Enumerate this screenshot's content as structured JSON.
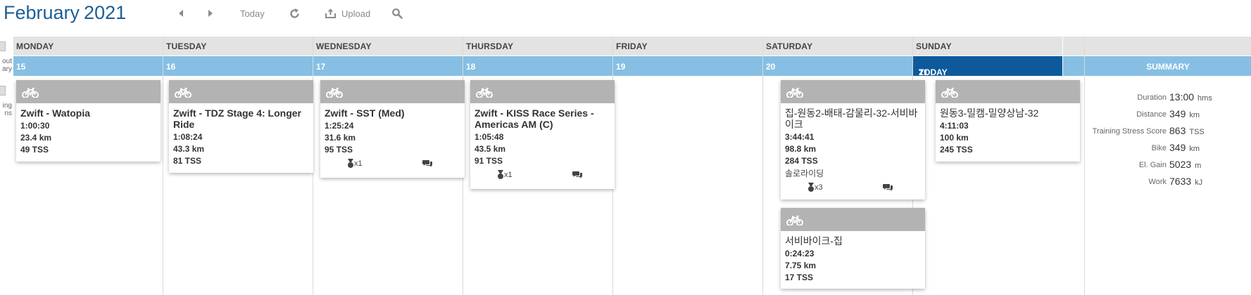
{
  "header": {
    "month": "February",
    "year": "2021",
    "today_label": "Today",
    "upload_label": "Upload"
  },
  "left_panel": {
    "item1_lines": [
      "out",
      "ary"
    ],
    "item2_lines": [
      "ing",
      "ns"
    ]
  },
  "days": [
    {
      "name": "MONDAY",
      "date": "15"
    },
    {
      "name": "TUESDAY",
      "date": "16"
    },
    {
      "name": "WEDNESDAY",
      "date": "17"
    },
    {
      "name": "THURSDAY",
      "date": "18"
    },
    {
      "name": "FRIDAY",
      "date": "19"
    },
    {
      "name": "SATURDAY",
      "date": "20"
    },
    {
      "name": "SUNDAY",
      "date": "21",
      "today_label": "TODAY"
    }
  ],
  "workouts": {
    "mon": {
      "title": "Zwift - Watopia",
      "duration": "1:00:30",
      "distance": "23.4 km",
      "tss": "49 TSS"
    },
    "tue": {
      "title": "Zwift - TDZ Stage 4: Longer Ride",
      "duration": "1:08:24",
      "distance": "43.3 km",
      "tss": "81 TSS"
    },
    "wed": {
      "title": "Zwift - SST (Med)",
      "duration": "1:25:24",
      "distance": "31.6 km",
      "tss": "95 TSS",
      "medals": "x1"
    },
    "thu": {
      "title": "Zwift - KISS Race Series - Americas AM (C)",
      "duration": "1:05:48",
      "distance": "43.5 km",
      "tss": "91 TSS",
      "medals": "x1"
    },
    "sat1": {
      "title": "집-원동2-배태-감물리-32-서비바이크",
      "duration": "3:44:41",
      "distance": "98.8 km",
      "tss": "284 TSS",
      "note": "솔로라이딩",
      "medals": "x3"
    },
    "sat2": {
      "title": "서비바이크-집",
      "duration": "0:24:23",
      "distance": "7.75 km",
      "tss": "17 TSS"
    },
    "sun": {
      "title": "원동3-밀캠-밀양상남-32",
      "duration": "4:11:03",
      "distance": "100 km",
      "tss": "245 TSS"
    }
  },
  "summary": {
    "title": "SUMMARY",
    "rows": [
      {
        "label": "Duration",
        "value": "13:00",
        "unit": "hms"
      },
      {
        "label": "Distance",
        "value": "349",
        "unit": "km"
      },
      {
        "label": "Training Stress Score",
        "value": "863",
        "unit": "TSS"
      },
      {
        "label": "Bike",
        "value": "349",
        "unit": "km"
      },
      {
        "label": "El. Gain",
        "value": "5023",
        "unit": "m"
      },
      {
        "label": "Work",
        "value": "7633",
        "unit": "kJ"
      }
    ]
  },
  "colors": {
    "title_blue": "#1f5e96",
    "date_bar": "#86bfe3",
    "today_bar": "#0c5a9c",
    "card_header": "#b3b3b3",
    "day_header_bg": "#e3e3e3"
  },
  "icons": [
    "chevron-left-icon",
    "chevron-right-icon",
    "refresh-icon",
    "upload-icon",
    "search-icon",
    "bike-icon",
    "medal-icon",
    "comment-icon"
  ]
}
